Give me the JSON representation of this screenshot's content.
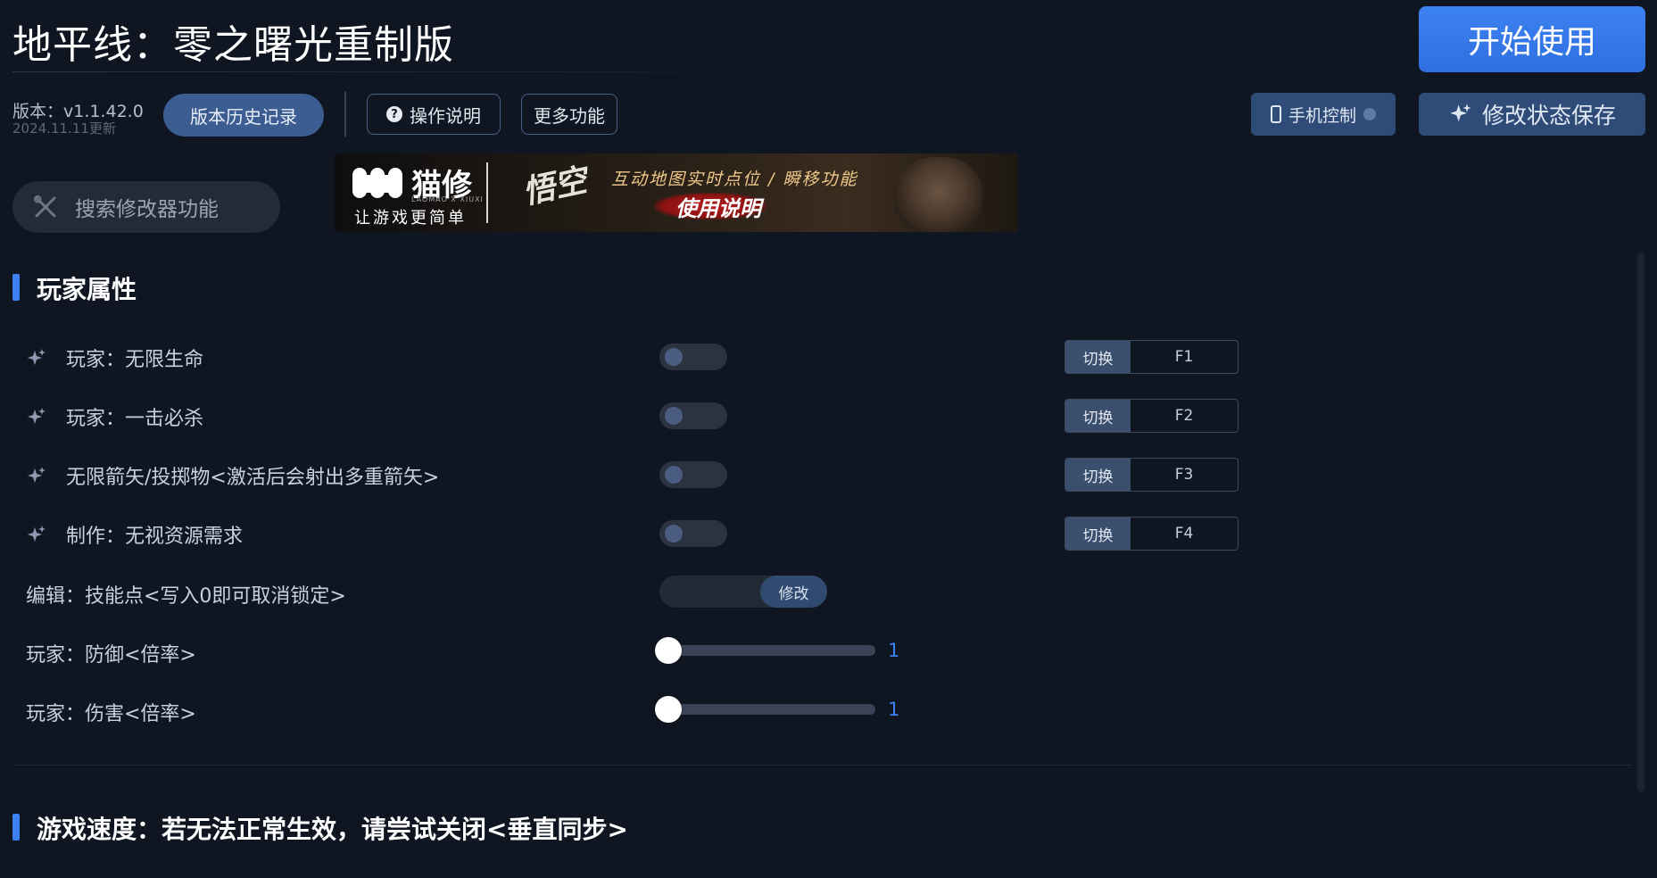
{
  "header": {
    "title": "地平线：零之曙光重制版",
    "start_label": "开始使用",
    "version_label": "版本：v1.1.42.0",
    "version_date": "2024.11.11更新",
    "history_label": "版本历史记录",
    "help_label": "操作说明",
    "help_icon_char": "?",
    "more_label": "更多功能",
    "phone_label": "手机控制",
    "save_label": "修改状态保存"
  },
  "search": {
    "placeholder": "搜索修改器功能"
  },
  "banner": {
    "brand": "猫修",
    "brand_small": "LAOMAO X XIUXI",
    "slogan": "让游戏更简单",
    "calligraphy": "悟空",
    "feature": "互动地图实时点位 / 瞬移功能",
    "guide": "使用说明"
  },
  "sections": [
    {
      "title": "玩家属性",
      "rows": [
        {
          "label": "玩家：无限生命",
          "toggle_on": false,
          "hotkey_tag": "切换",
          "hotkey": "F1"
        },
        {
          "label": "玩家：一击必杀",
          "toggle_on": false,
          "hotkey_tag": "切换",
          "hotkey": "F2"
        },
        {
          "label": "无限箭矢/投掷物<激活后会射出多重箭矢>",
          "toggle_on": false,
          "hotkey_tag": "切换",
          "hotkey": "F3"
        },
        {
          "label": "制作：无视资源需求",
          "toggle_on": false,
          "hotkey_tag": "切换",
          "hotkey": "F4"
        }
      ],
      "edit_row": {
        "label": "编辑：技能点<写入0即可取消锁定>",
        "button": "修改"
      },
      "sliders": [
        {
          "label": "玩家：防御<倍率>",
          "value": "1",
          "fraction": 0
        },
        {
          "label": "玩家：伤害<倍率>",
          "value": "1",
          "fraction": 0
        }
      ]
    },
    {
      "title": "游戏速度：若无法正常生效，请尝试关闭<垂直同步>"
    }
  ],
  "colors": {
    "accent": "#3d82f2",
    "background": "#0f1621",
    "toggle_off": "#2b3340"
  }
}
